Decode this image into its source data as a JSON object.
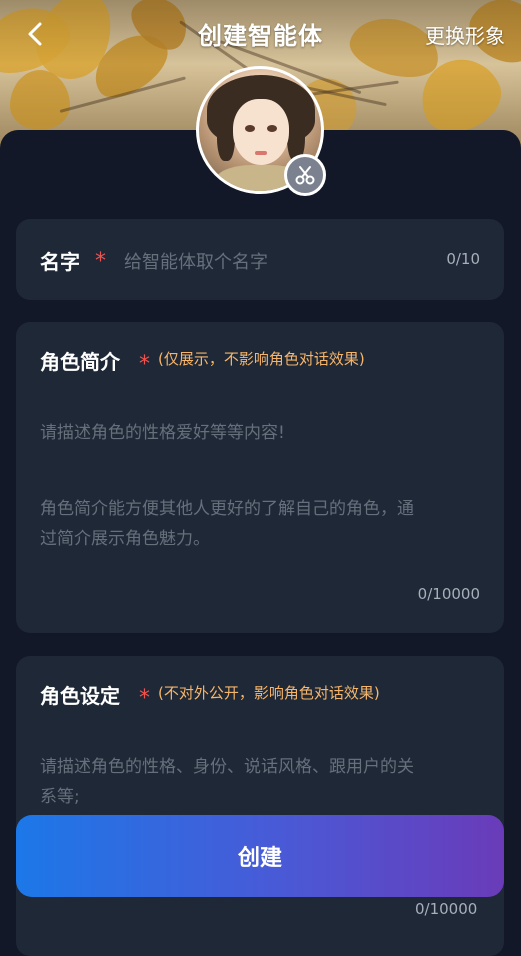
{
  "header": {
    "title": "创建智能体",
    "change_avatar_label": "更换形象"
  },
  "icons": {
    "back": "chevron-left-icon",
    "crop": "scissors-icon",
    "required": "asterisk"
  },
  "form": {
    "name": {
      "label": "名字",
      "required_mark": "*",
      "placeholder": "给智能体取个名字",
      "counter": "0/10"
    },
    "intro": {
      "label": "角色简介",
      "required_mark": "*",
      "note": "(仅展示，不影响角色对话效果)",
      "placeholder_line1": "请描述角色的性格爱好等等内容!",
      "placeholder_line2": "角色简介能方便其他人更好的了解自己的角色，通",
      "placeholder_line3": "过简介展示角色魅力。",
      "counter": "0/10000"
    },
    "setting": {
      "label": "角色设定",
      "required_mark": "*",
      "note": "(不对外公开，影响角色对话效果)",
      "placeholder_line1": "请描述角色的性格、身份、说话风格、跟用户的关",
      "placeholder_line2": "系等;",
      "counter": "0/10000"
    }
  },
  "actions": {
    "create_label": "创建"
  },
  "colors": {
    "background": "#121827",
    "card": "#1e2836",
    "required": "#ef5350",
    "note": "#f7b56a",
    "button_gradient_start": "#1c78e8",
    "button_gradient_end": "#6a3bb9"
  }
}
